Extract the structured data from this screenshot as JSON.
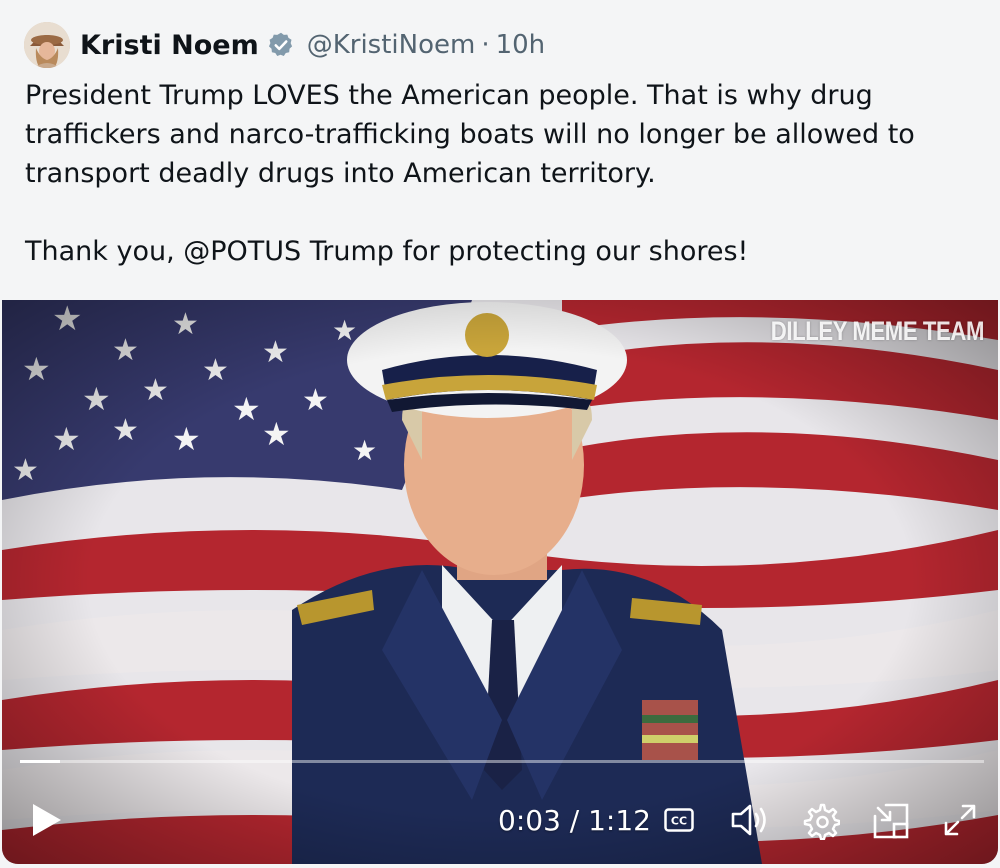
{
  "tweet": {
    "author_name": "Kristi Noem",
    "handle": "@KristiNoem",
    "separator": "·",
    "time": "10h",
    "text_line1": "President Trump LOVES the American people. That is why drug traffickers and narco-trafficking boats will no longer be allowed to transport deadly drugs into American territory.",
    "text_line2": "Thank you, @POTUS Trump for protecting our shores!"
  },
  "media": {
    "watermark": "DILLEY MEME TEAM",
    "timecode": "0:03 / 1:12",
    "progress_fraction": 0.042
  },
  "icons": {
    "avatar": "avatar-image",
    "verified": "verified-badge-icon",
    "play": "play-icon",
    "cc": "closed-captions-icon",
    "volume": "volume-icon",
    "settings": "gear-icon",
    "pip": "picture-in-picture-icon",
    "fullscreen": "fullscreen-icon"
  },
  "colors": {
    "verified": "#829aab",
    "text": "#0f1419",
    "muted": "#536471"
  }
}
